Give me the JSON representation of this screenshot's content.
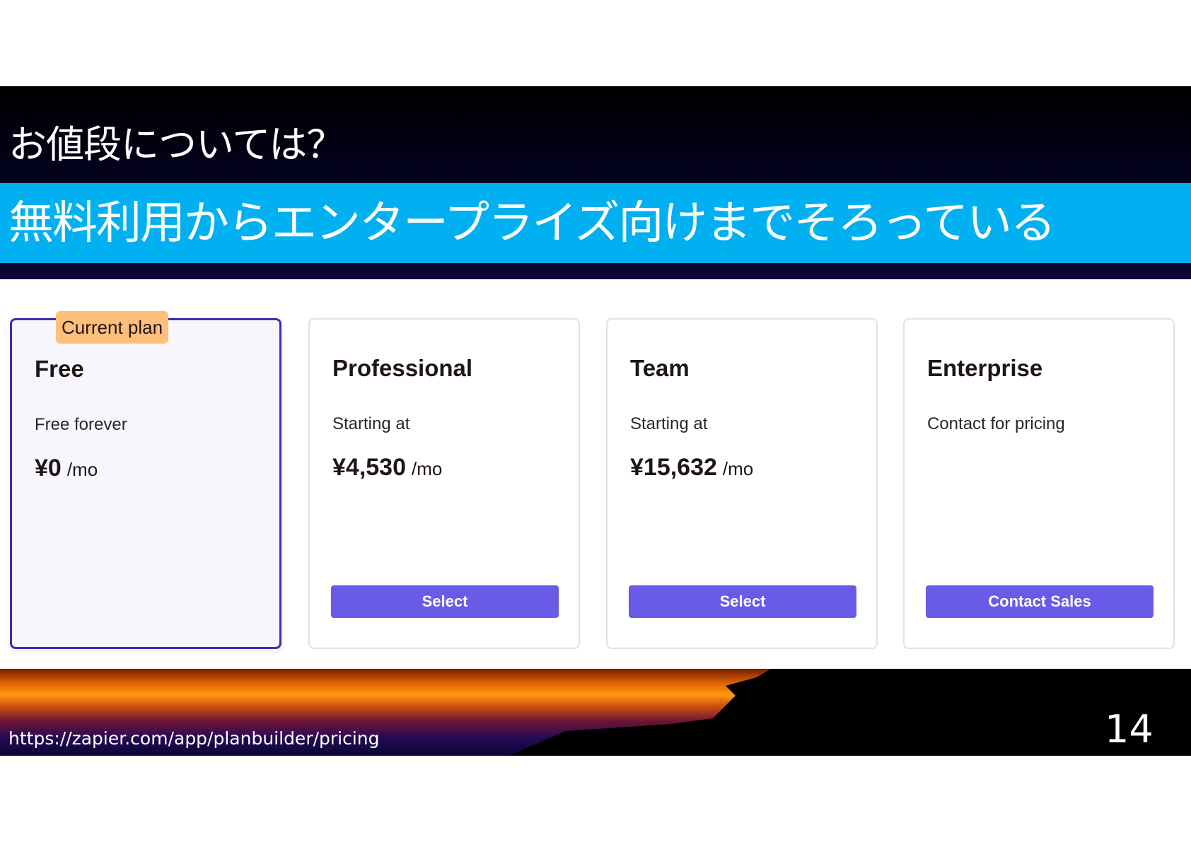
{
  "slide": {
    "heading": "お値段については？",
    "subtitle": "無料利用からエンタープライズ向けまでそろっている",
    "source_url": "https://zapier.com/app/planbuilder/pricing",
    "page_number": "14"
  },
  "plans": [
    {
      "name": "Free",
      "badge": "Current plan",
      "caption": "Free forever",
      "price": "¥0",
      "period": "/mo"
    },
    {
      "name": "Professional",
      "caption": "Starting at",
      "price": "¥4,530",
      "period": "/mo",
      "button_label": "Select"
    },
    {
      "name": "Team",
      "caption": "Starting at",
      "price": "¥15,632",
      "period": "/mo",
      "button_label": "Select"
    },
    {
      "name": "Enterprise",
      "caption": "Contact for pricing",
      "button_label": "Contact Sales"
    }
  ],
  "colors": {
    "header_background": "#02011a",
    "subtitle_bar": "#00b0f0",
    "button": "#695be8",
    "current_plan_border": "#3d2db3",
    "badge": "#ffbf7a"
  }
}
